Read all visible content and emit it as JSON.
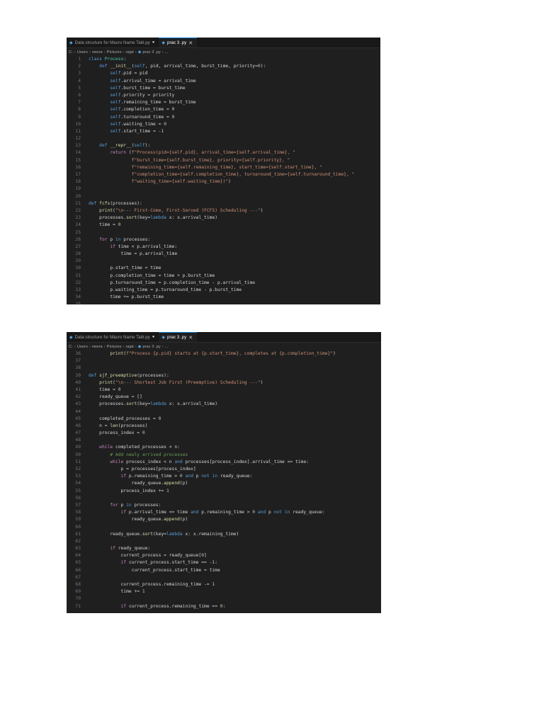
{
  "editors": [
    {
      "tabs": [
        {
          "label": "Data structure for Macro Name Tabl.py",
          "modified": true,
          "active": false
        },
        {
          "label": "prac 3 .py",
          "modified": false,
          "active": true
        }
      ],
      "breadcrumb": [
        "C:",
        "Users",
        "neera",
        "Pictures",
        "rajat",
        "prac 3 .py",
        "..."
      ],
      "lines": [
        {
          "n": "1",
          "t": "class Process:"
        },
        {
          "n": "2",
          "t": "    def __init__(self, pid, arrival_time, burst_time, priority=0):"
        },
        {
          "n": "3",
          "t": "        self.pid = pid"
        },
        {
          "n": "4",
          "t": "        self.arrival_time = arrival_time"
        },
        {
          "n": "5",
          "t": "        self.burst_time = burst_time"
        },
        {
          "n": "6",
          "t": "        self.priority = priority"
        },
        {
          "n": "7",
          "t": "        self.remaining_time = burst_time"
        },
        {
          "n": "8",
          "t": "        self.completion_time = 0"
        },
        {
          "n": "9",
          "t": "        self.turnaround_time = 0"
        },
        {
          "n": "10",
          "t": "        self.waiting_time = 0"
        },
        {
          "n": "11",
          "t": "        self.start_time = -1"
        },
        {
          "n": "12",
          "t": ""
        },
        {
          "n": "13",
          "t": "    def __repr__(self):"
        },
        {
          "n": "14",
          "t": "        return (f\"Process(pid={self.pid}, arrival_time={self.arrival_time}, \""
        },
        {
          "n": "15",
          "t": "                f\"burst_time={self.burst_time}, priority={self.priority}, \""
        },
        {
          "n": "16",
          "t": "                f\"remaining_time={self.remaining_time}, start_time={self.start_time}, \""
        },
        {
          "n": "17",
          "t": "                f\"completion_time={self.completion_time}, turnaround_time={self.turnaround_time}, \""
        },
        {
          "n": "18",
          "t": "                f\"waiting_time={self.waiting_time})\")"
        },
        {
          "n": "19",
          "t": ""
        },
        {
          "n": "20",
          "t": ""
        },
        {
          "n": "21",
          "t": "def fcfs(processes):"
        },
        {
          "n": "22",
          "t": "    print(\"\\n--- First-Come, First-Served (FCFS) Scheduling ---\")"
        },
        {
          "n": "23",
          "t": "    processes.sort(key=lambda x: x.arrival_time)"
        },
        {
          "n": "24",
          "t": "    time = 0"
        },
        {
          "n": "25",
          "t": ""
        },
        {
          "n": "26",
          "t": "    for p in processes:"
        },
        {
          "n": "27",
          "t": "        if time < p.arrival_time:"
        },
        {
          "n": "28",
          "t": "            time = p.arrival_time"
        },
        {
          "n": "29",
          "t": ""
        },
        {
          "n": "30",
          "t": "        p.start_time = time"
        },
        {
          "n": "31",
          "t": "        p.completion_time = time + p.burst_time"
        },
        {
          "n": "32",
          "t": "        p.turnaround_time = p.completion_time - p.arrival_time"
        },
        {
          "n": "33",
          "t": "        p.waiting_time = p.turnaround_time - p.burst_time"
        },
        {
          "n": "34",
          "t": "        time += p.burst_time"
        },
        {
          "n": "35",
          "t": ""
        },
        {
          "n": "36",
          "t": "        print(f\"Process {p.pid} starts at {p.start_time}, completes at {p.completion_time}\")"
        }
      ]
    },
    {
      "tabs": [
        {
          "label": "Data structure for Macro Name Tabl.py",
          "modified": true,
          "active": false
        },
        {
          "label": "prac 3 .py",
          "modified": false,
          "active": true
        }
      ],
      "breadcrumb": [
        "C:",
        "Users",
        "neera",
        "Pictures",
        "rajat",
        "prac 3 .py",
        "..."
      ],
      "lines": [
        {
          "n": "36",
          "t": "        print(f\"Process {p.pid} starts at {p.start_time}, completes at {p.completion_time}\")"
        },
        {
          "n": "37",
          "t": ""
        },
        {
          "n": "38",
          "t": ""
        },
        {
          "n": "39",
          "t": "def sjf_preemptive(processes):"
        },
        {
          "n": "40",
          "t": "    print(\"\\n--- Shortest Job First (Preemptive) Scheduling ---\")"
        },
        {
          "n": "41",
          "t": "    time = 0"
        },
        {
          "n": "42",
          "t": "    ready_queue = []"
        },
        {
          "n": "43",
          "t": "    processes.sort(key=lambda x: x.arrival_time)"
        },
        {
          "n": "44",
          "t": ""
        },
        {
          "n": "45",
          "t": "    completed_processes = 0"
        },
        {
          "n": "46",
          "t": "    n = len(processes)"
        },
        {
          "n": "47",
          "t": "    process_index = 0"
        },
        {
          "n": "48",
          "t": ""
        },
        {
          "n": "49",
          "t": "    while completed_processes < n:"
        },
        {
          "n": "50",
          "t": "        # Add newly arrived processes"
        },
        {
          "n": "51",
          "t": "        while process_index < n and processes[process_index].arrival_time <= time:"
        },
        {
          "n": "52",
          "t": "            p = processes[process_index]"
        },
        {
          "n": "53",
          "t": "            if p.remaining_time > 0 and p not in ready_queue:"
        },
        {
          "n": "54",
          "t": "                ready_queue.append(p)"
        },
        {
          "n": "55",
          "t": "            process_index += 1"
        },
        {
          "n": "56",
          "t": ""
        },
        {
          "n": "57",
          "t": "        for p in processes:"
        },
        {
          "n": "58",
          "t": "            if p.arrival_time <= time and p.remaining_time > 0 and p not in ready_queue:"
        },
        {
          "n": "59",
          "t": "                ready_queue.append(p)"
        },
        {
          "n": "60",
          "t": ""
        },
        {
          "n": "61",
          "t": "        ready_queue.sort(key=lambda x: x.remaining_time)"
        },
        {
          "n": "62",
          "t": ""
        },
        {
          "n": "63",
          "t": "        if ready_queue:"
        },
        {
          "n": "64",
          "t": "            current_process = ready_queue[0]"
        },
        {
          "n": "65",
          "t": "            if current_process.start_time == -1:"
        },
        {
          "n": "66",
          "t": "                current_process.start_time = time"
        },
        {
          "n": "67",
          "t": ""
        },
        {
          "n": "68",
          "t": "            current_process.remaining_time -= 1"
        },
        {
          "n": "69",
          "t": "            time += 1"
        },
        {
          "n": "70",
          "t": ""
        },
        {
          "n": "71",
          "t": "            if current_process.remaining_time == 0:"
        }
      ]
    }
  ]
}
